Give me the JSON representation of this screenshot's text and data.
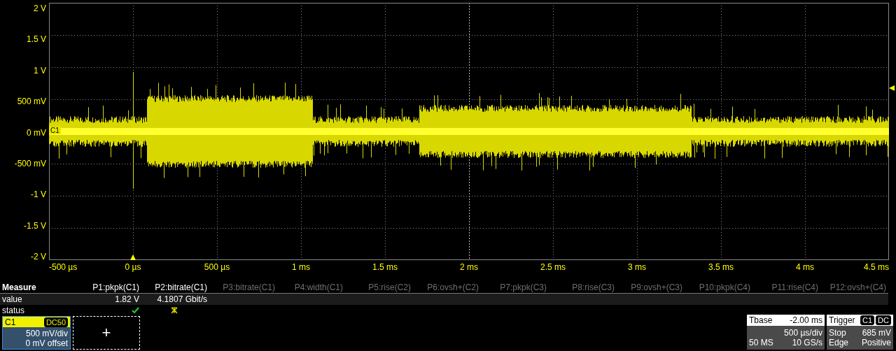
{
  "y_axis_labels": [
    "2 V",
    "1.5 V",
    "1 V",
    "500 mV",
    "0 mV",
    "-500 mV",
    "-1 V",
    "-1.5 V",
    "-2 V"
  ],
  "x_axis_labels": [
    "-500 µs",
    "0 µs",
    "500 µs",
    "1 ms",
    "1.5 ms",
    "2 ms",
    "2.5 ms",
    "3 ms",
    "3.5 ms",
    "4 ms",
    "4.5 ms"
  ],
  "channel_marker": "C1",
  "measure": {
    "title": "Measure",
    "row_labels": [
      "value",
      "status"
    ],
    "columns": [
      {
        "label": "P1:pkpk(C1)",
        "active": true,
        "value": "1.82 V",
        "status": {
          "kind": "ok"
        }
      },
      {
        "label": "P2:bitrate(C1)",
        "active": true,
        "value": "4.1807 Gbit/s",
        "status": {
          "kind": "warning"
        }
      },
      {
        "label": "P3:bitrate(C1)",
        "active": false
      },
      {
        "label": "P4:width(C1)",
        "active": false
      },
      {
        "label": "P5:rise(C2)",
        "active": false
      },
      {
        "label": "P6:ovsh+(C2)",
        "active": false
      },
      {
        "label": "P7:pkpk(C3)",
        "active": false
      },
      {
        "label": "P8:rise(C3)",
        "active": false
      },
      {
        "label": "P9:ovsh+(C3)",
        "active": false
      },
      {
        "label": "P10:pkpk(C4)",
        "active": false
      },
      {
        "label": "P11:rise(C4)",
        "active": false
      },
      {
        "label": "P12:ovsh+(C4)",
        "active": false
      }
    ]
  },
  "channel": {
    "name": "C1",
    "coupling": "DC50",
    "scale": "500 mV/div",
    "offset": "0 mV offset"
  },
  "add_button": "+",
  "timebase": {
    "title": "Tbase",
    "delay": "-2.00 ms",
    "scale": "500 µs/div",
    "samples": "50 MS",
    "rate": "10 GS/s"
  },
  "trigger": {
    "title": "Trigger",
    "source": "C1",
    "coupling": "DC",
    "mode": "Stop",
    "level": "685 mV",
    "type": "Edge",
    "slope": "Positive"
  }
}
